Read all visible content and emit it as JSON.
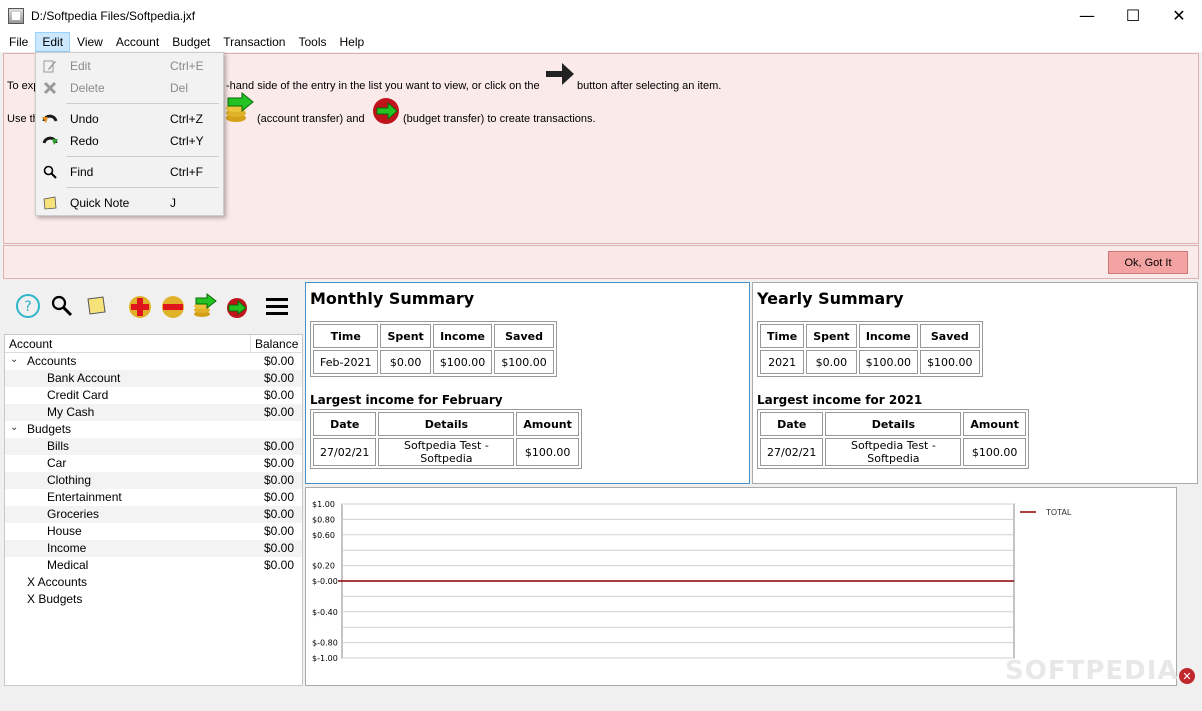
{
  "window": {
    "title": "D:/Softpedia Files/Softpedia.jxf",
    "min": "—",
    "max": "☐",
    "close": "✕"
  },
  "menubar": [
    "File",
    "Edit",
    "View",
    "Account",
    "Budget",
    "Transaction",
    "Tools",
    "Help"
  ],
  "edit_menu": [
    {
      "label": "Edit",
      "shortcut": "Ctrl+E",
      "icon": "edit-icon",
      "disabled": true
    },
    {
      "label": "Delete",
      "shortcut": "Del",
      "icon": "delete-icon",
      "disabled": true
    },
    {
      "label": "Undo",
      "shortcut": "Ctrl+Z",
      "icon": "undo-icon",
      "disabled": false
    },
    {
      "label": "Redo",
      "shortcut": "Ctrl+Y",
      "icon": "redo-icon",
      "disabled": false
    },
    {
      "label": "Find",
      "shortcut": "Ctrl+F",
      "icon": "search-icon",
      "disabled": false
    },
    {
      "label": "Quick Note",
      "shortcut": "J",
      "icon": "note-icon",
      "disabled": false
    }
  ],
  "info": {
    "line1_start": "To exp",
    "line1_mid": "-hand side of the entry in the list you want to view, or click on the",
    "line1_end": "button after selecting an item.",
    "line2_start": "Use th",
    "line2_mid": "(account transfer) and",
    "line2_end": "(budget transfer) to create transactions.",
    "ok_button": "Ok, Got It"
  },
  "tree": {
    "header": {
      "account": "Account",
      "balance": "Balance"
    },
    "rows": [
      {
        "label": "Accounts",
        "balance": "$0.00",
        "level": 0,
        "expand": true
      },
      {
        "label": "Bank Account",
        "balance": "$0.00",
        "level": 1
      },
      {
        "label": "Credit Card",
        "balance": "$0.00",
        "level": 1
      },
      {
        "label": "My Cash",
        "balance": "$0.00",
        "level": 1
      },
      {
        "label": "Budgets",
        "balance": "",
        "level": 0,
        "expand": true
      },
      {
        "label": "Bills",
        "balance": "$0.00",
        "level": 1
      },
      {
        "label": "Car",
        "balance": "$0.00",
        "level": 1
      },
      {
        "label": "Clothing",
        "balance": "$0.00",
        "level": 1
      },
      {
        "label": "Entertainment",
        "balance": "$0.00",
        "level": 1
      },
      {
        "label": "Groceries",
        "balance": "$0.00",
        "level": 1
      },
      {
        "label": "House",
        "balance": "$0.00",
        "level": 1
      },
      {
        "label": "Income",
        "balance": "$0.00",
        "level": 1
      },
      {
        "label": "Medical",
        "balance": "$0.00",
        "level": 1
      },
      {
        "label": "X Accounts",
        "balance": "",
        "level": 2
      },
      {
        "label": "X Budgets",
        "balance": "",
        "level": 2
      }
    ]
  },
  "monthly": {
    "title": "Monthly Summary",
    "headers": [
      "Time",
      "Spent",
      "Income",
      "Saved"
    ],
    "row": [
      "Feb-2021",
      "$0.00",
      "$100.00",
      "$100.00"
    ],
    "largest_title": "Largest income for February",
    "largest_headers": [
      "Date",
      "Details",
      "Amount"
    ],
    "largest_row": [
      "27/02/21",
      "Softpedia Test - Softpedia",
      "$100.00"
    ]
  },
  "yearly": {
    "title": "Yearly Summary",
    "headers": [
      "Time",
      "Spent",
      "Income",
      "Saved"
    ],
    "row": [
      "2021",
      "$0.00",
      "$100.00",
      "$100.00"
    ],
    "largest_title": "Largest income for 2021",
    "largest_headers": [
      "Date",
      "Details",
      "Amount"
    ],
    "largest_row": [
      "27/02/21",
      "Softpedia Test - Softpedia",
      "$100.00"
    ]
  },
  "chart": {
    "legend": "TOTAL",
    "color": "#8b0000",
    "ticks": [
      {
        "label": "$1.00",
        "value": 1.0
      },
      {
        "label": "$0.80",
        "value": 0.8
      },
      {
        "label": "$0.60",
        "value": 0.6
      },
      {
        "label": "$0.20",
        "value": 0.2
      },
      {
        "label": "$-0.00",
        "value": 0.0
      },
      {
        "label": "$-0.40",
        "value": -0.4
      },
      {
        "label": "$-0.80",
        "value": -0.8
      },
      {
        "label": "$-1.00",
        "value": -1.0
      }
    ],
    "total_value": 0
  },
  "watermark": "SOFTPEDIA"
}
